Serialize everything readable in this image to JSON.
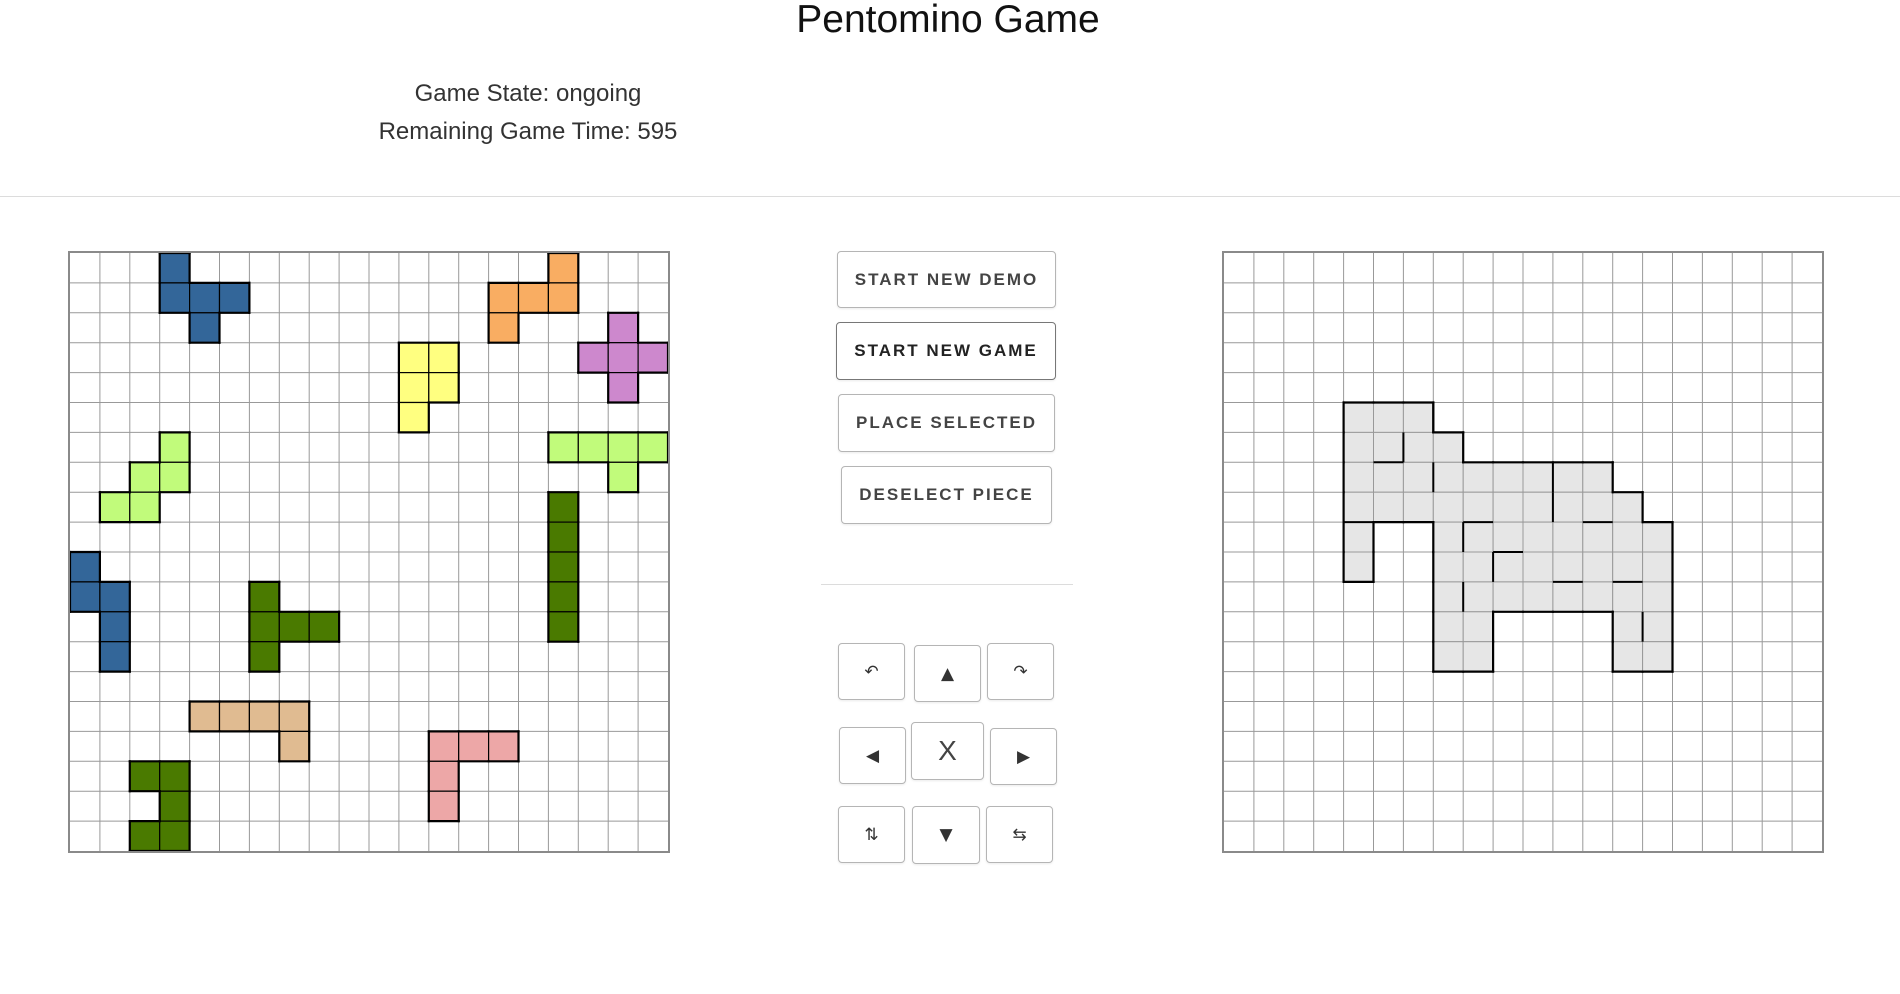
{
  "header": {
    "title": "Pentomino Game",
    "game_state_text": "Game State: ongoing",
    "remaining_time_text": "Remaining Game Time: 595"
  },
  "buttons": {
    "start_demo": "START NEW DEMO",
    "start_game": "START NEW GAME",
    "place_selected": "PLACE SELECTED",
    "deselect_piece": "DESELECT PIECE"
  },
  "controls": {
    "rotate_left": "↶",
    "move_up": "▲",
    "rotate_right": "↷",
    "move_left": "◀",
    "x_label": "X",
    "move_right": "▶",
    "flip_vertical": "⇅",
    "move_down": "▼",
    "flip_horizontal": "⇆"
  },
  "board": {
    "rows": 20,
    "cols": 20,
    "grid_color": "#999999",
    "outline_color": "#000000"
  },
  "pieces": [
    {
      "name": "I",
      "color": "#4a7a00",
      "cells": [
        [
          8,
          16
        ],
        [
          9,
          16
        ],
        [
          10,
          16
        ],
        [
          11,
          16
        ],
        [
          12,
          16
        ]
      ]
    },
    {
      "name": "N",
      "color": "#f9ad62",
      "cells": [
        [
          0,
          16
        ],
        [
          1,
          14
        ],
        [
          1,
          15
        ],
        [
          1,
          16
        ],
        [
          2,
          14
        ]
      ]
    },
    {
      "name": "L",
      "color": "#eda7a7",
      "cells": [
        [
          16,
          12
        ],
        [
          16,
          13
        ],
        [
          16,
          14
        ],
        [
          17,
          12
        ],
        [
          18,
          12
        ]
      ]
    },
    {
      "name": "P",
      "color": "#ffff80",
      "cells": [
        [
          3,
          11
        ],
        [
          3,
          12
        ],
        [
          4,
          11
        ],
        [
          4,
          12
        ],
        [
          5,
          11
        ]
      ]
    },
    {
      "name": "U",
      "color": "#4a7a00",
      "cells": [
        [
          17,
          2
        ],
        [
          17,
          3
        ],
        [
          18,
          3
        ],
        [
          19,
          2
        ],
        [
          19,
          3
        ]
      ]
    },
    {
      "name": "V",
      "color": "#e0bb91",
      "cells": [
        [
          15,
          4
        ],
        [
          15,
          5
        ],
        [
          15,
          6
        ],
        [
          15,
          7
        ],
        [
          16,
          7
        ]
      ]
    },
    {
      "name": "W",
      "color": "#c1fb7b",
      "cells": [
        [
          6,
          3
        ],
        [
          7,
          2
        ],
        [
          7,
          3
        ],
        [
          8,
          1
        ],
        [
          8,
          2
        ]
      ]
    },
    {
      "name": "X",
      "color": "#cd88cd",
      "cells": [
        [
          2,
          18
        ],
        [
          3,
          17
        ],
        [
          3,
          18
        ],
        [
          3,
          19
        ],
        [
          4,
          18
        ]
      ]
    },
    {
      "name": "Y",
      "color": "#c1fb7b",
      "cells": [
        [
          6,
          16
        ],
        [
          6,
          17
        ],
        [
          6,
          18
        ],
        [
          6,
          19
        ],
        [
          7,
          18
        ]
      ]
    },
    {
      "name": "Z",
      "color": "#4a7a00",
      "cells": [
        [
          11,
          6
        ],
        [
          12,
          6
        ],
        [
          12,
          7
        ],
        [
          12,
          8
        ],
        [
          13,
          6
        ]
      ]
    },
    {
      "name": "F",
      "color": "#336699",
      "cells": [
        [
          0,
          3
        ],
        [
          1,
          3
        ],
        [
          1,
          4
        ],
        [
          1,
          5
        ],
        [
          2,
          4
        ]
      ]
    },
    {
      "name": "N2",
      "color": "#336699",
      "cells": [
        [
          10,
          0
        ],
        [
          11,
          0
        ],
        [
          11,
          1
        ],
        [
          12,
          1
        ],
        [
          13,
          1
        ]
      ]
    }
  ],
  "target_shape": {
    "fill_color": "#e6e6e6",
    "cells": [
      [
        5,
        4
      ],
      [
        5,
        5
      ],
      [
        5,
        6
      ],
      [
        6,
        4
      ],
      [
        6,
        5
      ],
      [
        6,
        6
      ],
      [
        6,
        7
      ],
      [
        7,
        4
      ],
      [
        7,
        5
      ],
      [
        7,
        6
      ],
      [
        7,
        7
      ],
      [
        7,
        8
      ],
      [
        7,
        9
      ],
      [
        7,
        10
      ],
      [
        7,
        11
      ],
      [
        7,
        12
      ],
      [
        8,
        4
      ],
      [
        8,
        5
      ],
      [
        8,
        6
      ],
      [
        8,
        7
      ],
      [
        8,
        8
      ],
      [
        8,
        9
      ],
      [
        8,
        10
      ],
      [
        8,
        11
      ],
      [
        8,
        12
      ],
      [
        8,
        13
      ],
      [
        9,
        4
      ],
      [
        9,
        7
      ],
      [
        9,
        8
      ],
      [
        9,
        9
      ],
      [
        9,
        10
      ],
      [
        9,
        11
      ],
      [
        9,
        12
      ],
      [
        9,
        13
      ],
      [
        9,
        14
      ],
      [
        10,
        4
      ],
      [
        10,
        7
      ],
      [
        10,
        8
      ],
      [
        10,
        9
      ],
      [
        10,
        10
      ],
      [
        10,
        11
      ],
      [
        10,
        12
      ],
      [
        10,
        13
      ],
      [
        10,
        14
      ],
      [
        11,
        7
      ],
      [
        11,
        8
      ],
      [
        11,
        9
      ],
      [
        11,
        10
      ],
      [
        11,
        11
      ],
      [
        11,
        12
      ],
      [
        11,
        13
      ],
      [
        11,
        14
      ],
      [
        12,
        7
      ],
      [
        12,
        8
      ],
      [
        12,
        13
      ],
      [
        12,
        14
      ],
      [
        13,
        7
      ],
      [
        13,
        8
      ],
      [
        13,
        13
      ],
      [
        13,
        14
      ]
    ],
    "inner_dividers": [
      [
        [
          5,
          6
        ],
        [
          5,
          7
        ]
      ],
      [
        [
          6,
          5
        ],
        [
          6,
          6
        ]
      ],
      [
        [
          6,
          5
        ],
        [
          7,
          5
        ]
      ],
      [
        [
          7,
          6
        ],
        [
          7,
          7
        ]
      ],
      [
        [
          7,
          10
        ],
        [
          7,
          11
        ]
      ],
      [
        [
          8,
          4
        ],
        [
          9,
          4
        ]
      ],
      [
        [
          8,
          8
        ],
        [
          9,
          8
        ]
      ],
      [
        [
          8,
          10
        ],
        [
          8,
          11
        ]
      ],
      [
        [
          8,
          12
        ],
        [
          9,
          12
        ]
      ],
      [
        [
          9,
          7
        ],
        [
          9,
          8
        ]
      ],
      [
        [
          9,
          9
        ],
        [
          10,
          9
        ]
      ],
      [
        [
          10,
          8
        ],
        [
          10,
          9
        ]
      ],
      [
        [
          10,
          11
        ],
        [
          11,
          11
        ]
      ],
      [
        [
          10,
          13
        ],
        [
          11,
          13
        ]
      ],
      [
        [
          11,
          7
        ],
        [
          11,
          8
        ]
      ],
      [
        [
          12,
          13
        ],
        [
          12,
          14
        ]
      ]
    ]
  }
}
